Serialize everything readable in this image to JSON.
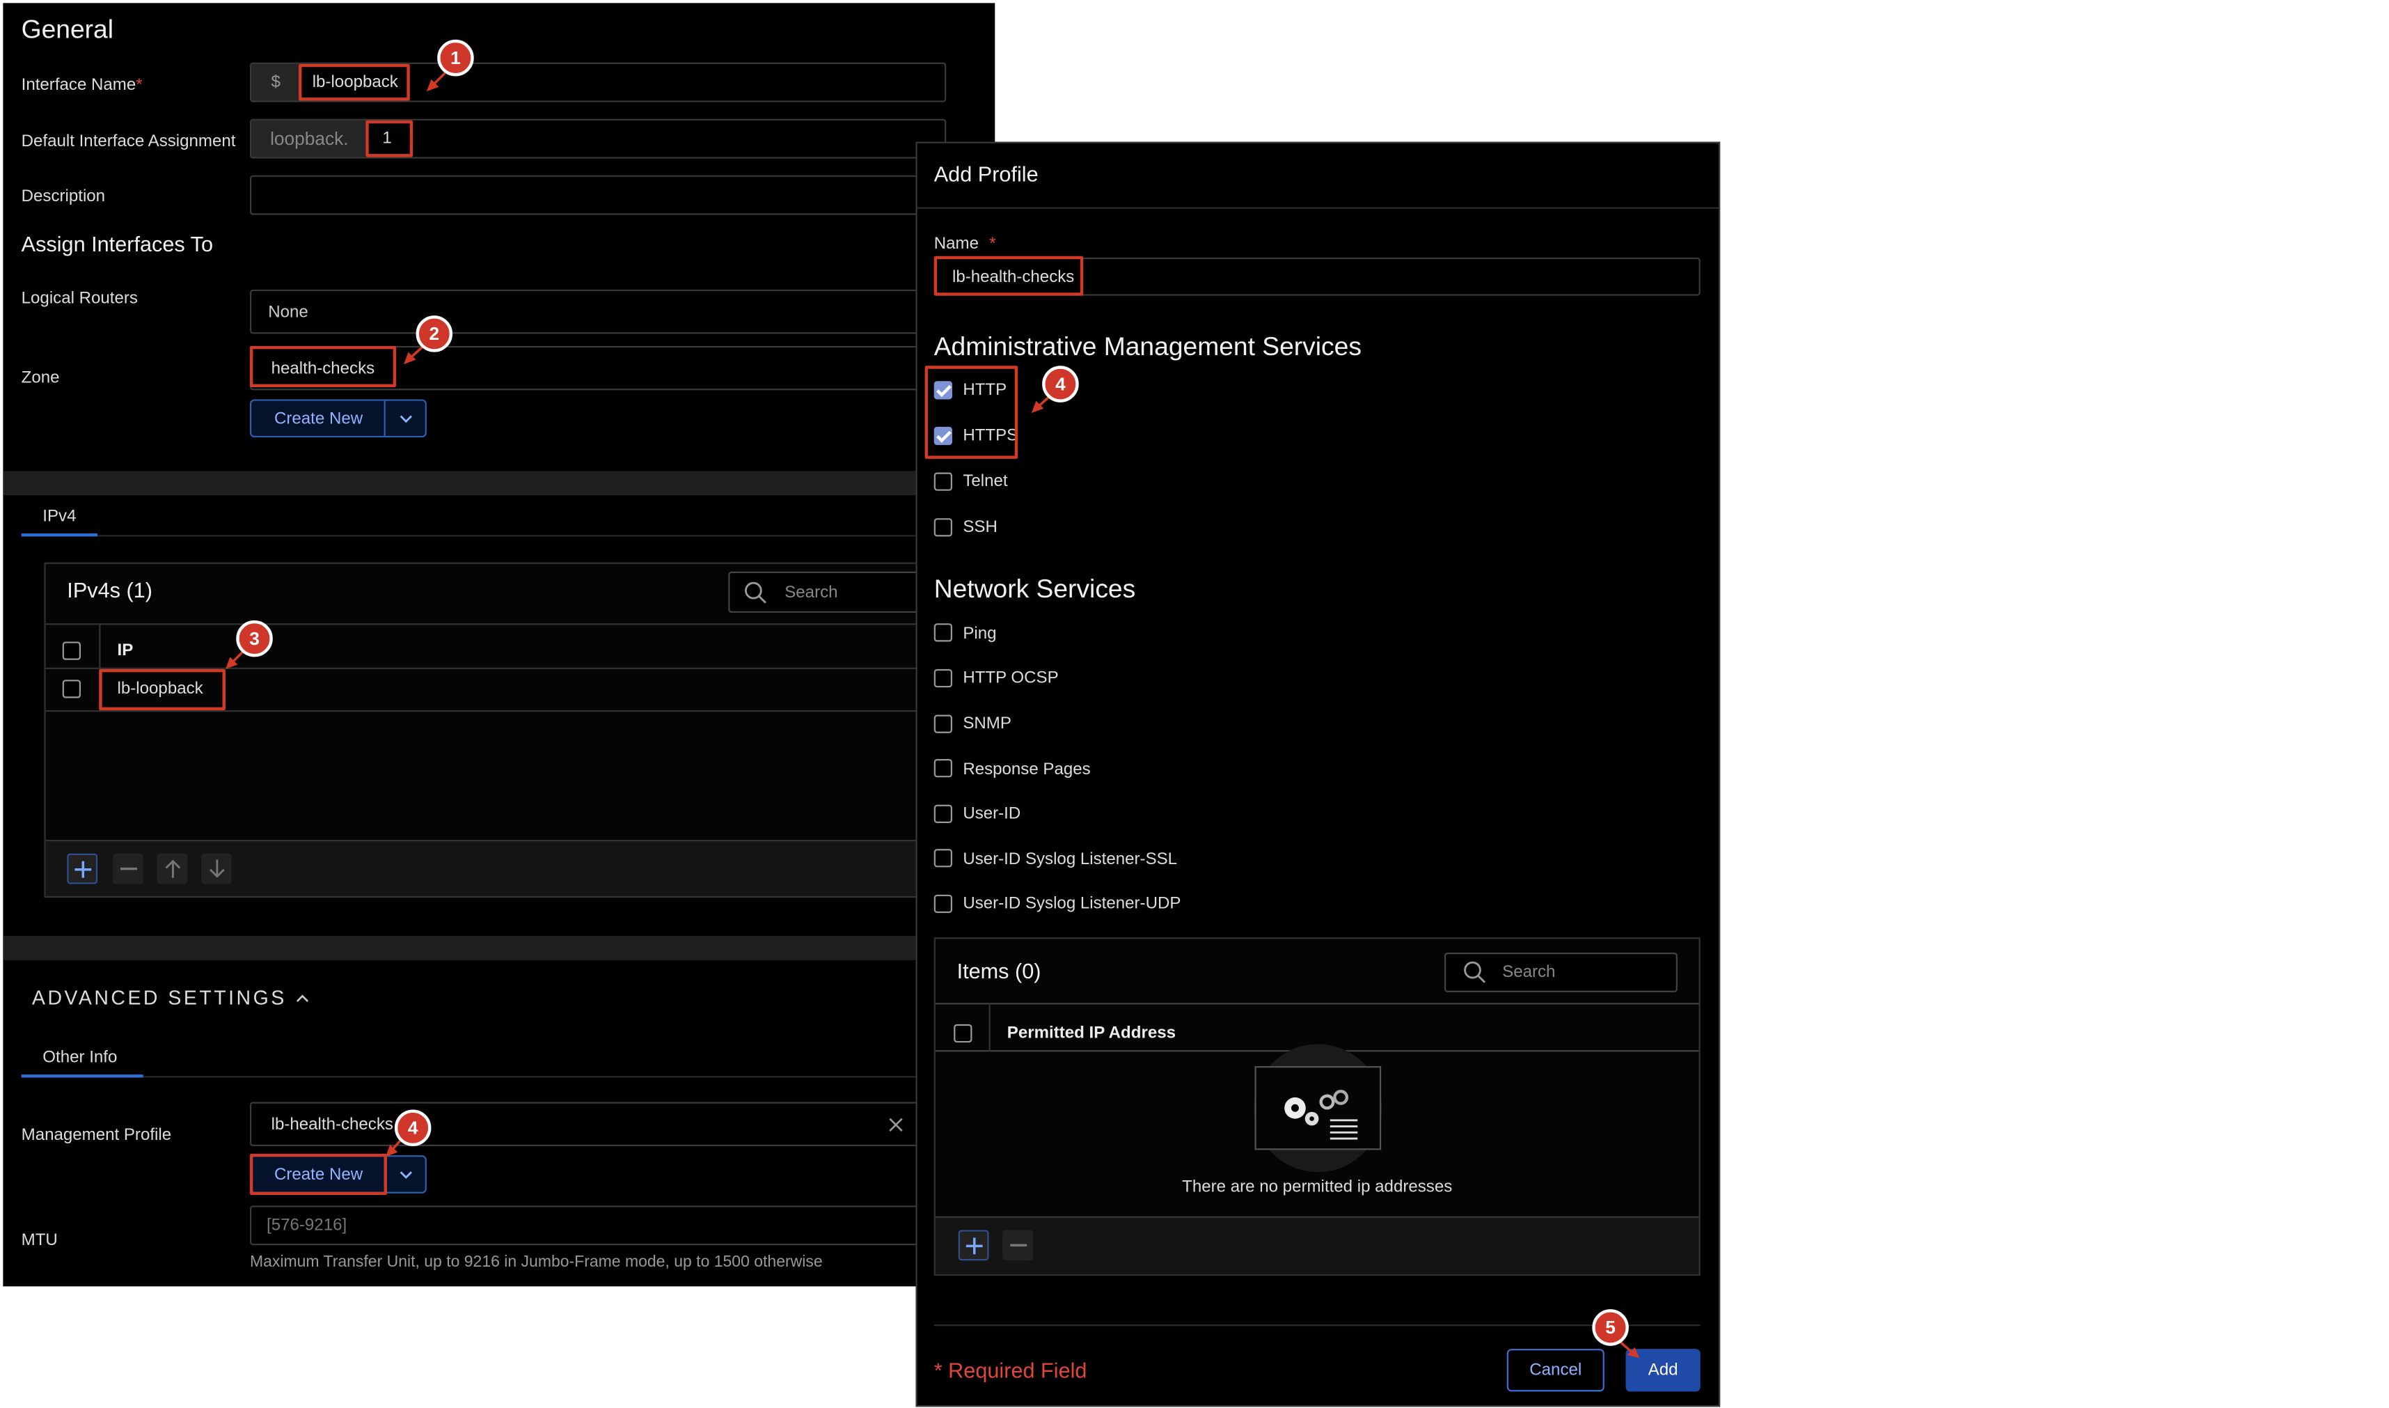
{
  "general": {
    "title": "General",
    "interface_name_label": "Interface Name",
    "required_mark": "*",
    "interface_prefix": "$",
    "interface_value": "lb-loopback",
    "default_assignment_label": "Default Interface Assignment",
    "default_assignment_prefix": "loopback.",
    "default_assignment_value": "1",
    "description_label": "Description",
    "assign_title": "Assign Interfaces To",
    "logical_routers_label": "Logical Routers",
    "logical_routers_value": "None",
    "zone_label": "Zone",
    "zone_value": "health-checks",
    "create_new_label": "Create New"
  },
  "ipv4": {
    "tab_label": "IPv4",
    "table_title": "IPv4s (1)",
    "search_placeholder": "Search",
    "column_ip": "IP",
    "rows": [
      "lb-loopback"
    ]
  },
  "advanced": {
    "title": "ADVANCED SETTINGS",
    "tab_label": "Other Info",
    "mgmt_profile_label": "Management Profile",
    "mgmt_profile_value": "lb-health-checks",
    "create_new_label": "Create New",
    "mtu_label": "MTU",
    "mtu_placeholder": "[576-9216]",
    "mtu_help": "Maximum Transfer Unit, up to 9216 in Jumbo-Frame mode, up to 1500 otherwise"
  },
  "dialog": {
    "title": "Add Profile",
    "name_label": "Name",
    "required_mark": "*",
    "name_value": "lb-health-checks",
    "admin_title": "Administrative Management Services",
    "admin_services": [
      {
        "label": "HTTP",
        "checked": true
      },
      {
        "label": "HTTPS",
        "checked": true
      },
      {
        "label": "Telnet",
        "checked": false
      },
      {
        "label": "SSH",
        "checked": false
      }
    ],
    "network_title": "Network Services",
    "network_services": [
      {
        "label": "Ping",
        "checked": false
      },
      {
        "label": "HTTP OCSP",
        "checked": false
      },
      {
        "label": "SNMP",
        "checked": false
      },
      {
        "label": "Response Pages",
        "checked": false
      },
      {
        "label": "User-ID",
        "checked": false
      },
      {
        "label": "User-ID Syslog Listener-SSL",
        "checked": false
      },
      {
        "label": "User-ID Syslog Listener-UDP",
        "checked": false
      }
    ],
    "items_title": "Items (0)",
    "search_placeholder": "Search",
    "column_permitted": "Permitted IP Address",
    "empty_text": "There are no permitted ip addresses",
    "required_field": "* Required Field",
    "cancel_label": "Cancel",
    "add_label": "Add"
  },
  "callouts": [
    "1",
    "2",
    "3",
    "4",
    "4",
    "5"
  ],
  "colors": {
    "accent_red": "#d23a27",
    "primary_blue": "#1f4aa8",
    "checkbox_on": "#7f94d6"
  }
}
